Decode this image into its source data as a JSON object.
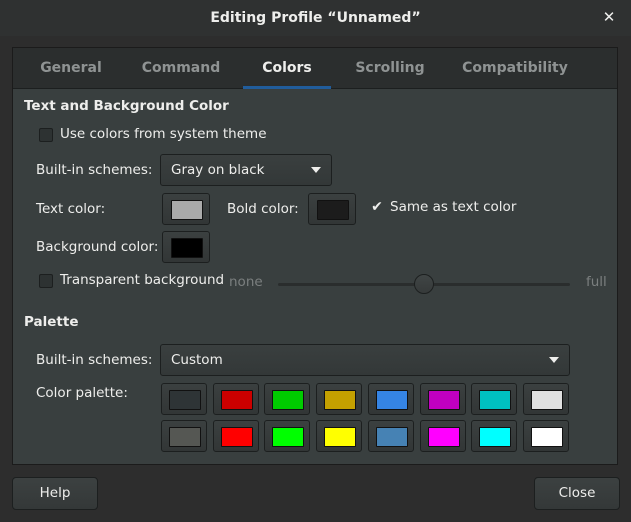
{
  "window": {
    "title": "Editing Profile “Unnamed”",
    "close_glyph": "✕"
  },
  "tabs": [
    {
      "label": "General",
      "active": false
    },
    {
      "label": "Command",
      "active": false
    },
    {
      "label": "Colors",
      "active": true
    },
    {
      "label": "Scrolling",
      "active": false
    },
    {
      "label": "Compatibility",
      "active": false
    }
  ],
  "text_bg": {
    "heading": "Text and Background Color",
    "use_system_label": "Use colors from system theme",
    "use_system_checked": false,
    "schemes_label": "Built-in schemes:",
    "schemes_value": "Gray on black",
    "text_color_label": "Text color:",
    "text_color": "#aaaaaa",
    "bold_color_label": "Bold color:",
    "bold_color": "#1c1c1c",
    "same_as_text_label": "Same as text color",
    "same_as_text_checked": true,
    "check_glyph": "✔",
    "bg_color_label": "Background color:",
    "bg_color": "#000000",
    "transparent_label": "Transparent background",
    "transparent_checked": false,
    "slider_min_label": "none",
    "slider_max_label": "full",
    "slider_value": 0.5
  },
  "palette": {
    "heading": "Palette",
    "schemes_label": "Built-in schemes:",
    "schemes_value": "Custom",
    "palette_label": "Color palette:",
    "row1": [
      "#2e3436",
      "#cc0000",
      "#00cc00",
      "#c4a000",
      "#3584e4",
      "#c000c0",
      "#00c0c0",
      "#e0e0e0"
    ],
    "row2": [
      "#555753",
      "#ff0000",
      "#00ff00",
      "#ffff00",
      "#4682b4",
      "#ff00ff",
      "#00ffff",
      "#ffffff"
    ]
  },
  "footer": {
    "help_label": "Help",
    "close_label": "Close"
  }
}
